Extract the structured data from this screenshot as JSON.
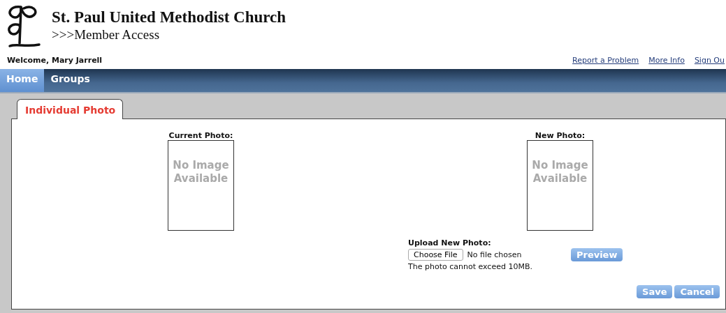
{
  "header": {
    "title": "St. Paul United Methodist Church",
    "subtitle": ">>>Member Access"
  },
  "welcome": "Welcome, Mary Jarrell",
  "top_links": [
    "Report a Problem",
    "More Info",
    "Sign Ou"
  ],
  "nav": [
    {
      "label": "Home",
      "selected": true
    },
    {
      "label": "Groups",
      "selected": false
    }
  ],
  "tabs": [
    {
      "label": "Individual Photo",
      "selected": true
    }
  ],
  "photos": [
    {
      "label": "Current Photo:",
      "placeholder": "No Image Available"
    },
    {
      "label": "New Photo:",
      "placeholder": "No Image Available"
    }
  ],
  "upload": {
    "label": "Upload New Photo:",
    "button": "Choose File",
    "status": "No file chosen",
    "note": "The photo cannot exceed 10MB.",
    "preview": "Preview"
  },
  "actions": [
    "Save",
    "Cancel"
  ]
}
